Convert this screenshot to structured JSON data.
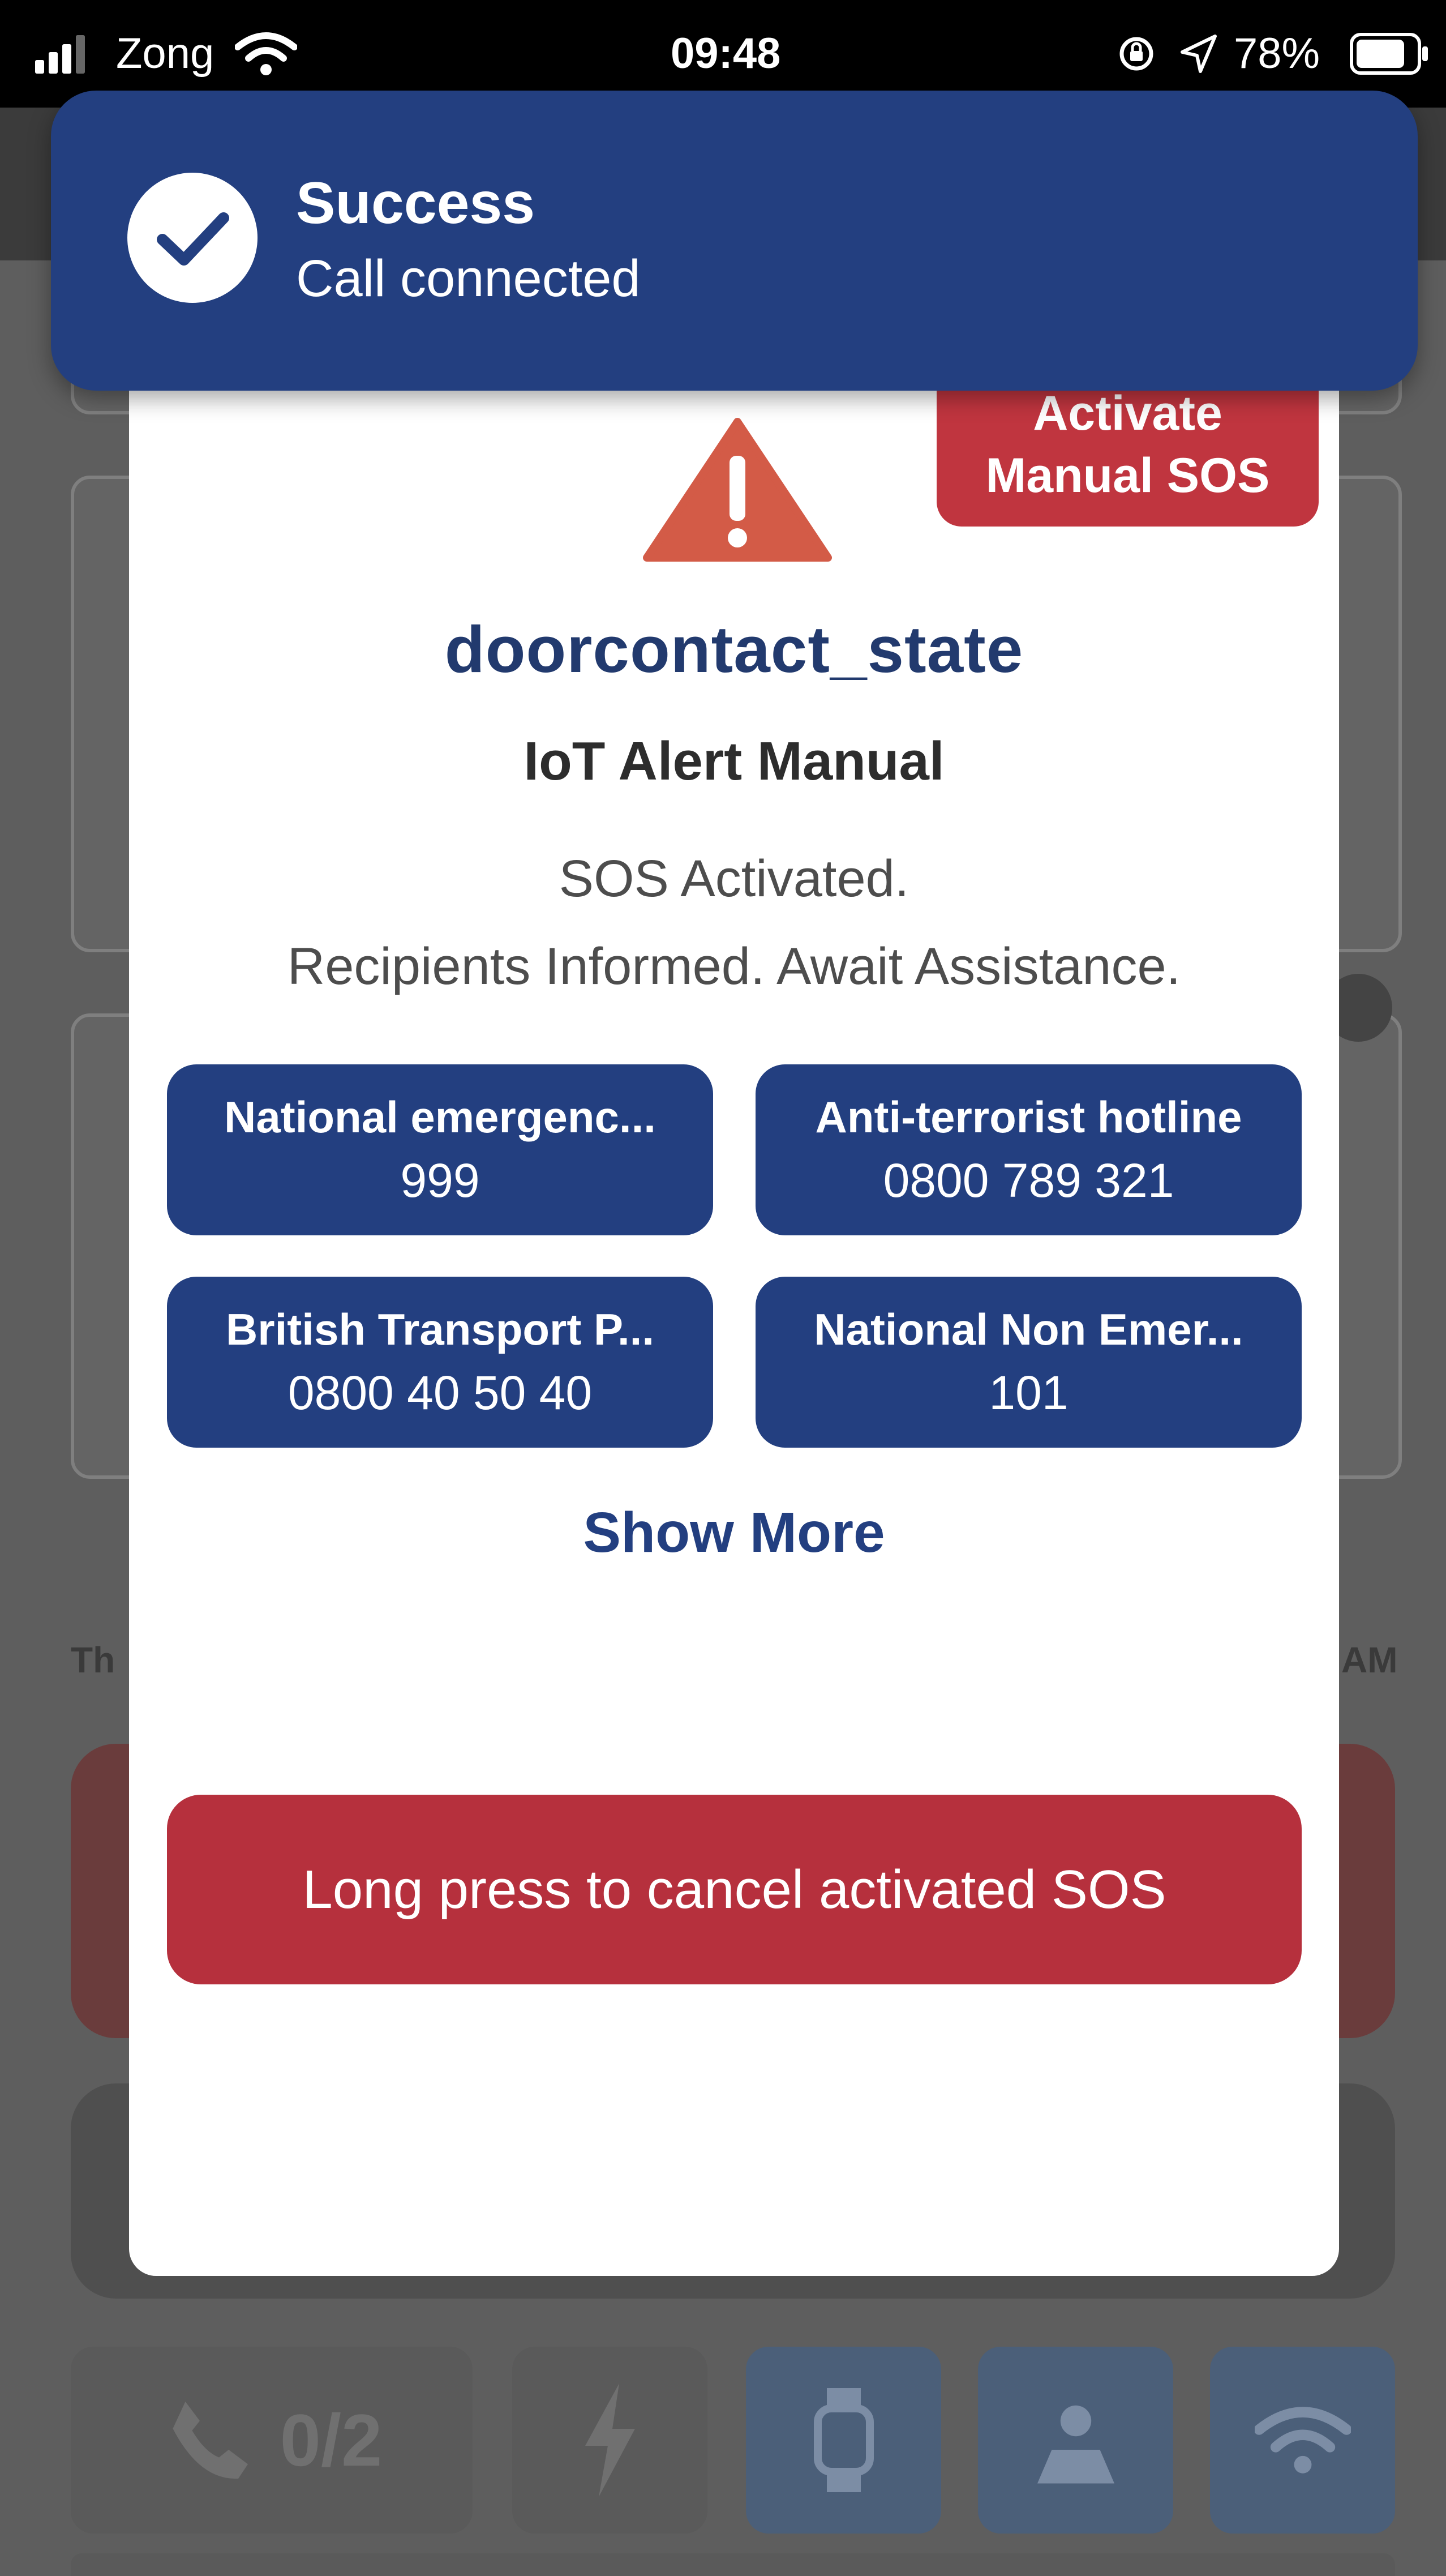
{
  "status_bar": {
    "carrier": "Zong",
    "time": "09:48",
    "battery": "78%"
  },
  "background": {
    "call_counter": "0/2",
    "left_fragment": "Th",
    "right_fragment": "AM"
  },
  "toast": {
    "title": "Success",
    "message": "Call connected"
  },
  "modal": {
    "manual_sos_line1": "Activate",
    "manual_sos_line2": "Manual SOS",
    "alert_name": "doorcontact_state",
    "alert_type": "IoT Alert Manual",
    "status_line1": "SOS Activated.",
    "status_line2": "Recipients Informed. Await Assistance.",
    "hotlines": [
      {
        "name": "National emergenc...",
        "number": "999"
      },
      {
        "name": "Anti-terrorist hotline",
        "number": "0800 789 321"
      },
      {
        "name": "British Transport P...",
        "number": "0800 40 50 40"
      },
      {
        "name": "National Non Emer...",
        "number": "101"
      }
    ],
    "show_more": "Show More",
    "cancel_label": "Long press to cancel activated SOS"
  },
  "colors": {
    "primary": "#233f80",
    "danger": "#c0353f",
    "warning_icon": "#d35b47"
  },
  "icons": [
    "signal-icon",
    "wifi-icon",
    "lock-rotation-icon",
    "location-arrow-icon",
    "battery-icon",
    "check-icon",
    "warning-icon",
    "phone-icon",
    "lightning-icon",
    "watch-icon",
    "map-user-icon",
    "wifi-tile-icon"
  ]
}
